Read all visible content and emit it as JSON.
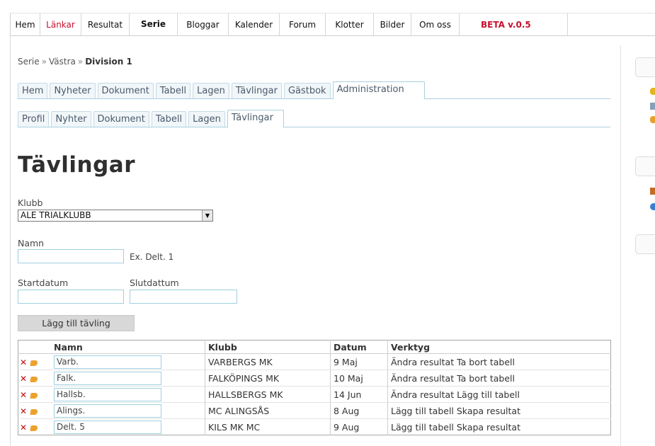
{
  "topnav": {
    "items": [
      {
        "label": "Hem"
      },
      {
        "label": "Länkar"
      },
      {
        "label": "Resultat"
      },
      {
        "label": "Serie"
      },
      {
        "label": "Bloggar"
      },
      {
        "label": "Kalender"
      },
      {
        "label": "Forum"
      },
      {
        "label": "Klotter"
      },
      {
        "label": "Bilder"
      },
      {
        "label": "Om oss"
      }
    ],
    "active": "Serie",
    "beta": "BETA v.0.5"
  },
  "breadcrumb": [
    "Serie",
    "Västra",
    "Division 1"
  ],
  "tabs1": [
    "Hem",
    "Nyheter",
    "Dokument",
    "Tabell",
    "Lagen",
    "Tävlingar",
    "Gästbok",
    "Administration"
  ],
  "tabs1_active": "Administration",
  "tabs2": [
    "Profil",
    "Nyhter",
    "Dokument",
    "Tabell",
    "Lagen",
    "Tävlingar"
  ],
  "tabs2_active": "Tävlingar",
  "page_title": "Tävlingar",
  "form": {
    "club_label": "Klubb",
    "club_value": "ALE TRIALKLUBB",
    "name_label": "Namn",
    "name_hint": "Ex. Delt. 1",
    "start_label": "Startdatum",
    "end_label": "Slutdattum",
    "submit": "Lägg till tävling"
  },
  "table": {
    "headers": [
      "Namn",
      "Klubb",
      "Datum",
      "Verktyg"
    ],
    "rows": [
      {
        "name": "Varb.",
        "club": "VARBERGS MK",
        "date": "9 Maj",
        "tools": "Ändra resultat Ta bort tabell"
      },
      {
        "name": "Falk.",
        "club": "FALKÖPINGS MK",
        "date": "10 Maj",
        "tools": "Ändra resultat Ta bort tabell"
      },
      {
        "name": "Hallsb.",
        "club": "HALLSBERGS MK",
        "date": "14 Jun",
        "tools": "Ändra resultat Lägg till tabell"
      },
      {
        "name": "Alings.",
        "club": "MC ALINGSÅS",
        "date": "8 Aug",
        "tools": "Lägg till tabell Skapa resultat"
      },
      {
        "name": "Delt. 5",
        "club": "KILS MK MC",
        "date": "9 Aug",
        "tools": "Lägg till tabell Skapa resultat"
      }
    ]
  },
  "colors": {
    "accent_red": "#c8102e",
    "tab_border": "#a9cfe0"
  }
}
